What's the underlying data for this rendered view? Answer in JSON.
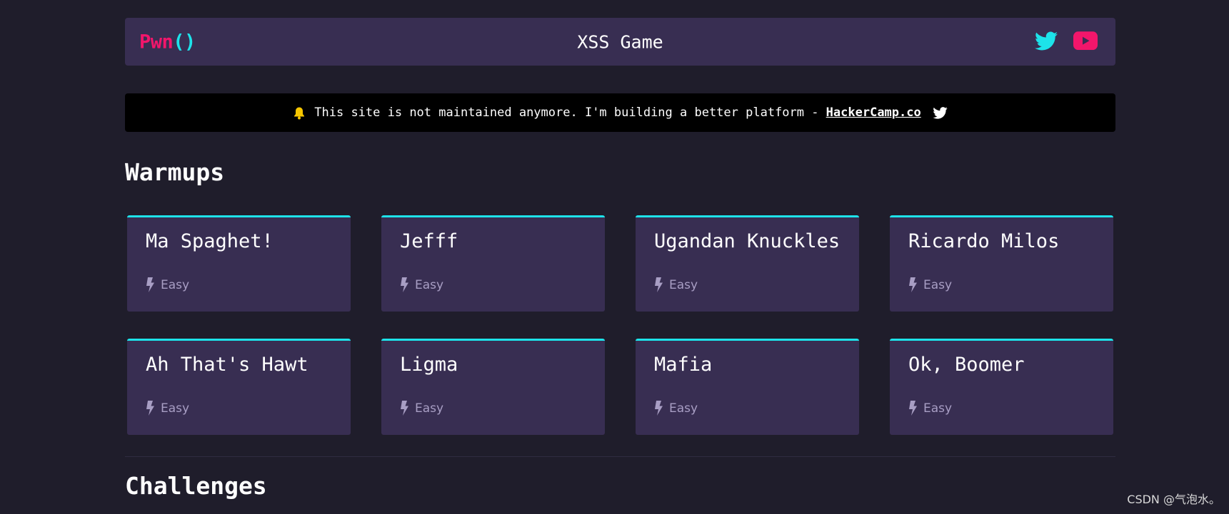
{
  "navbar": {
    "brand_main": "Pwn",
    "brand_parens": "()",
    "title": "XSS Game",
    "social": [
      {
        "icon": "twitter-icon",
        "color": "#1de3ea"
      },
      {
        "icon": "youtube-icon",
        "color": "#f2166b"
      }
    ]
  },
  "banner": {
    "icon": "bell-icon",
    "text": "This site is not maintained anymore. I'm building a better platform -",
    "link_text": "HackerCamp.co",
    "trailing_icon": "twitter-icon"
  },
  "sections": {
    "warmups_title": "Warmups",
    "challenges_title": "Challenges"
  },
  "cards": [
    {
      "title": "Ma Spaghet!",
      "difficulty": "Easy"
    },
    {
      "title": "Jefff",
      "difficulty": "Easy"
    },
    {
      "title": "Ugandan Knuckles",
      "difficulty": "Easy"
    },
    {
      "title": "Ricardo Milos",
      "difficulty": "Easy"
    },
    {
      "title": "Ah That's Hawt",
      "difficulty": "Easy"
    },
    {
      "title": "Ligma",
      "difficulty": "Easy"
    },
    {
      "title": "Mafia",
      "difficulty": "Easy"
    },
    {
      "title": "Ok, Boomer",
      "difficulty": "Easy"
    }
  ],
  "watermark": "CSDN @气泡水。",
  "colors": {
    "background": "#1f1d2b",
    "panel": "#382e52",
    "accent_cyan": "#1de3ea",
    "accent_pink": "#f2166b",
    "muted_text": "#a89ec4"
  }
}
